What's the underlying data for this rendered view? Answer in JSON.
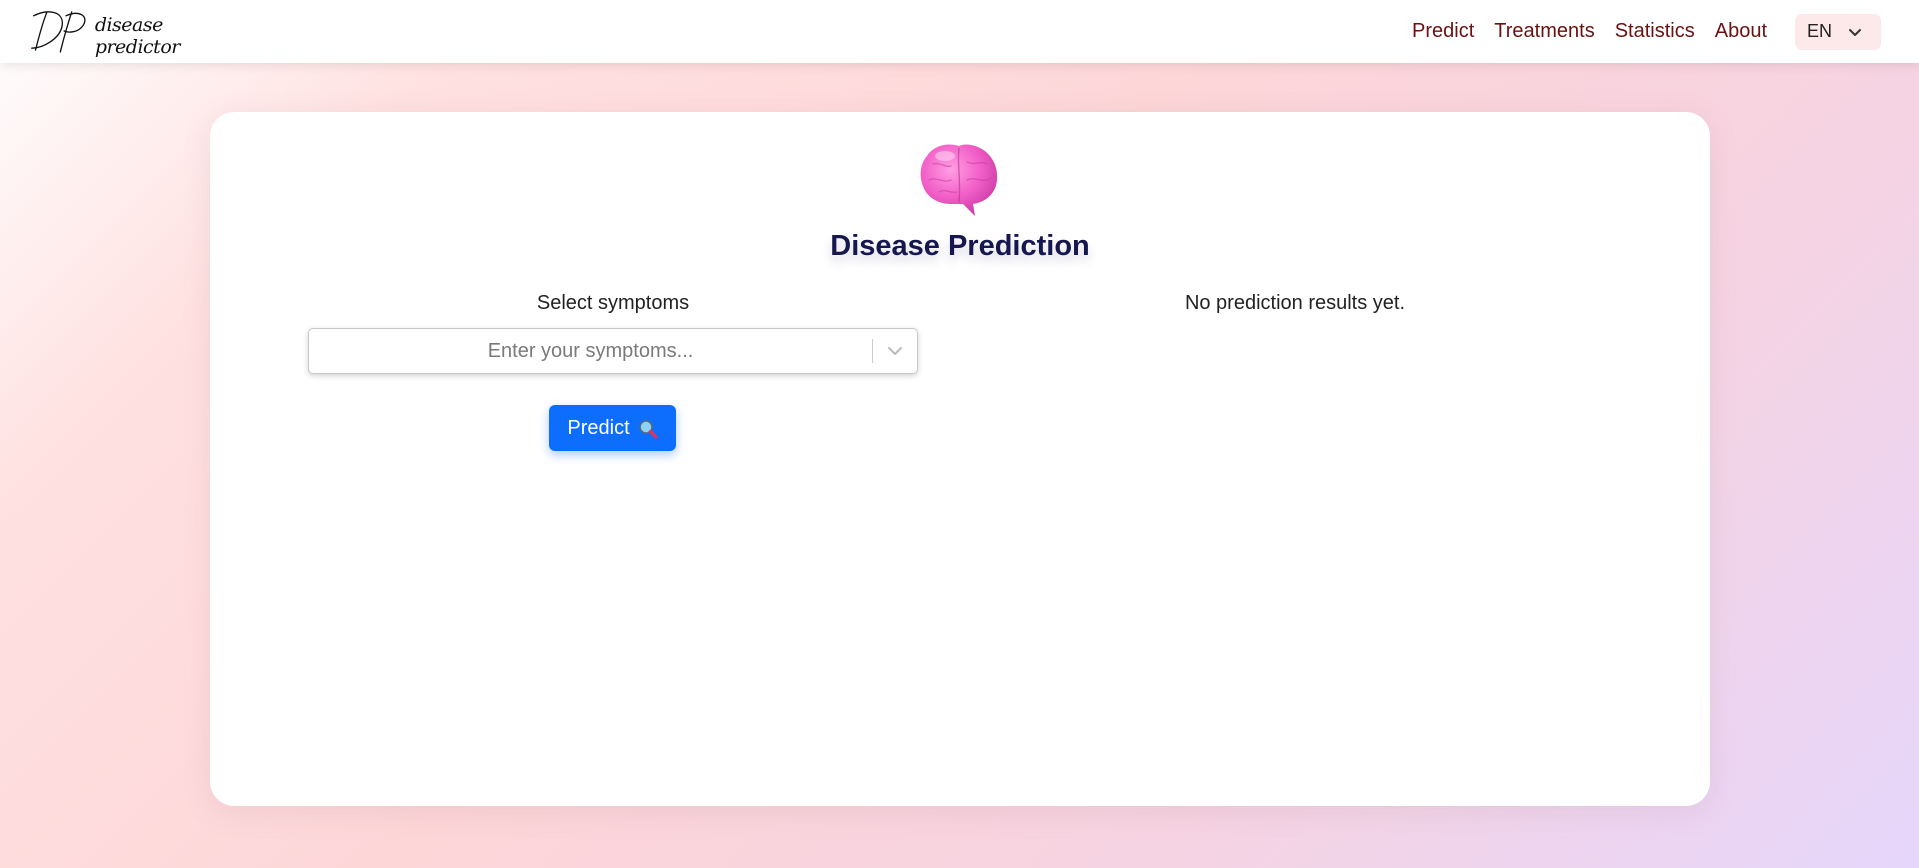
{
  "navbar": {
    "logo": {
      "monogram": "DP",
      "text": "disease predictor"
    },
    "links": [
      "Predict",
      "Treatments",
      "Statistics",
      "About"
    ],
    "language": {
      "selected": "EN",
      "icon": "chevron-down-icon"
    }
  },
  "main": {
    "icon": "brain-icon",
    "title": "Disease Prediction",
    "symptoms": {
      "label": "Select symptoms",
      "placeholder": "Enter your symptoms...",
      "value": "",
      "icon": "chevron-down-icon"
    },
    "predict_button": {
      "label": "Predict",
      "icon": "magnifier-icon"
    },
    "results_text": "No prediction results yet."
  },
  "colors": {
    "nav_link": "#6b1111",
    "title": "#16174f",
    "primary_button": "#0d6efd",
    "lang_bg": "#fde8ea",
    "brain": "#f25fc8"
  }
}
